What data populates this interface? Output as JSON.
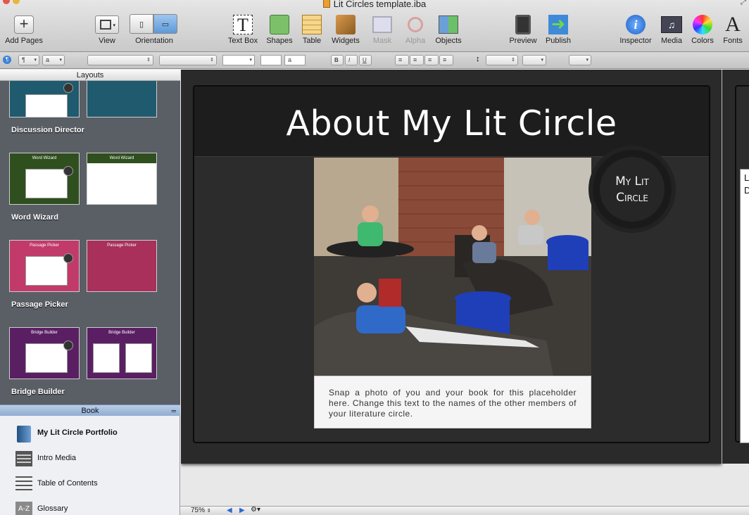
{
  "window": {
    "title": "Lit Circles template.iba"
  },
  "toolbar": {
    "add_pages": "Add Pages",
    "view": "View",
    "orientation": "Orientation",
    "text_box": "Text Box",
    "shapes": "Shapes",
    "table": "Table",
    "widgets": "Widgets",
    "mask": "Mask",
    "alpha": "Alpha",
    "objects": "Objects",
    "preview": "Preview",
    "publish": "Publish",
    "inspector": "Inspector",
    "media": "Media",
    "colors": "Colors",
    "fonts": "Fonts"
  },
  "formatbar": {
    "para_style": "¶",
    "char_style": "a",
    "bold": "B",
    "italic": "I",
    "underline": "U",
    "font_a": "a"
  },
  "sidebar": {
    "layouts_title": "Layouts",
    "layouts": [
      {
        "label": "Discussion Director",
        "color": "#1f5a6e"
      },
      {
        "label": "Word Wizard",
        "color": "#2f4f1f",
        "thumb_text": "Word Wizard"
      },
      {
        "label": "Passage Picker",
        "color": "#c23a6a",
        "thumb_text": "Passage Picker"
      },
      {
        "label": "Bridge Builder",
        "color": "#5a1f63",
        "thumb_text": "Bridge Builder"
      }
    ],
    "book_title": "Book",
    "book_items": [
      {
        "label": "My Lit Circle Portfolio",
        "icon": "book-icon"
      },
      {
        "label": "Intro Media",
        "icon": "film-icon"
      },
      {
        "label": "Table of Contents",
        "icon": "list-icon"
      },
      {
        "label": "Glossary",
        "icon": "glossary-icon",
        "icon_text": "A-Z"
      }
    ]
  },
  "page": {
    "title": "About My Lit Circle",
    "badge_line1": "My Lit",
    "badge_line2": "Circle",
    "caption": "Snap a photo of you and your book for this placeholder here.  Change this text to the names of the other members of your literature circle.",
    "next_page_text_1": "L",
    "next_page_text_2": "D"
  },
  "statusbar": {
    "zoom": "75%"
  }
}
